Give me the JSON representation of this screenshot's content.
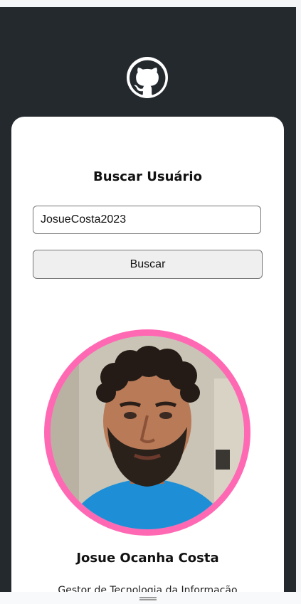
{
  "header": {
    "logo_icon": "github-icon"
  },
  "search": {
    "title": "Buscar Usuário",
    "input_value": "JosueCosta2023",
    "button_label": "Buscar"
  },
  "profile": {
    "name": "Josue Ocanha Costa",
    "bio": "Gestor de Tecnologia da Informação",
    "avatar_border_color": "#ff69b4"
  },
  "colors": {
    "background": "#24292e",
    "card": "#ffffff"
  }
}
